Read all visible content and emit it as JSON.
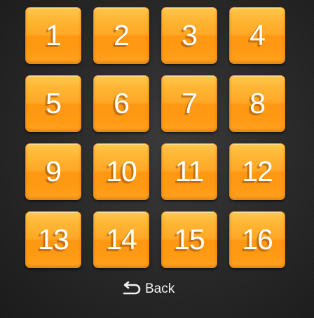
{
  "levels": [
    {
      "label": "1"
    },
    {
      "label": "2"
    },
    {
      "label": "3"
    },
    {
      "label": "4"
    },
    {
      "label": "5"
    },
    {
      "label": "6"
    },
    {
      "label": "7"
    },
    {
      "label": "8"
    },
    {
      "label": "9"
    },
    {
      "label": "10"
    },
    {
      "label": "11"
    },
    {
      "label": "12"
    },
    {
      "label": "13"
    },
    {
      "label": "14"
    },
    {
      "label": "15"
    },
    {
      "label": "16"
    }
  ],
  "back": {
    "label": "Back",
    "icon": "back-arrow-icon"
  },
  "colors": {
    "button_orange": "#ffa826",
    "background": "#2a2a2a",
    "text": "#ffffff"
  }
}
